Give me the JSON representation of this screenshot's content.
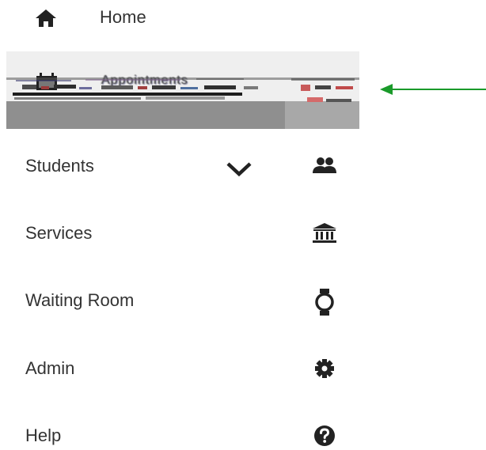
{
  "nav": {
    "home": {
      "label": "Home",
      "icon": "home-icon"
    },
    "appointments": {
      "label": "Appointments",
      "icon": "calendar-icon",
      "state": "rendering-glitch"
    },
    "items": [
      {
        "label": "Students",
        "icon": "people-icon",
        "expandable": true,
        "expand_icon": "chevron-down-icon"
      },
      {
        "label": "Services",
        "icon": "bank-icon"
      },
      {
        "label": "Waiting Room",
        "icon": "watch-icon"
      },
      {
        "label": "Admin",
        "icon": "gear-icon"
      },
      {
        "label": "Help",
        "icon": "help-circle-icon"
      }
    ]
  },
  "annotation": {
    "arrow_color": "#1a9a2a",
    "points_to": "appointments"
  },
  "colors": {
    "text": "#333333",
    "icon": "#222222",
    "highlight_bg": "#efefef"
  }
}
